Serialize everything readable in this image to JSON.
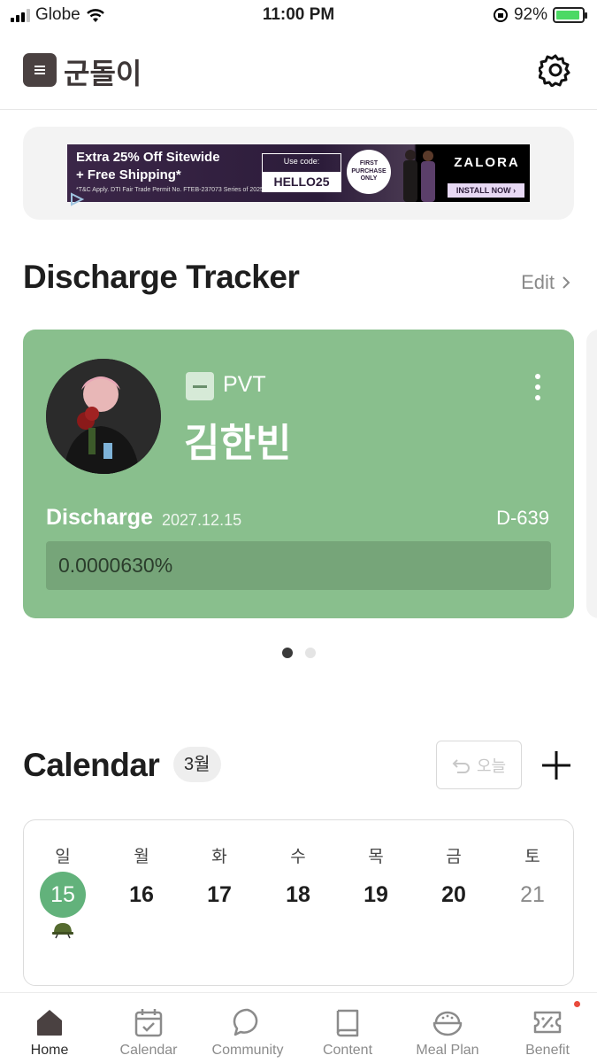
{
  "status_bar": {
    "carrier": "Globe",
    "time": "11:00 PM",
    "battery": "92%",
    "battery_level": 0.92
  },
  "header": {
    "title": "군돌이",
    "menu_icon": "menu-icon",
    "settings_icon": "gear-icon"
  },
  "ad": {
    "line1": "Extra 25% Off Sitewide",
    "line2": "+ Free Shipping*",
    "fine_print": "*T&C Apply. DTI Fair Trade Permit No. FTEB-237073 Series of 2025",
    "code_label": "Use code:",
    "code": "HELLO25",
    "badge": "FIRST PURCHASE ONLY",
    "brand": "ZALORA",
    "cta": "INSTALL NOW ›"
  },
  "discharge": {
    "title": "Discharge Tracker",
    "edit_label": "Edit",
    "card": {
      "rank": "PVT",
      "name": "김한빈",
      "discharge_label": "Discharge",
      "discharge_date": "2027.12.15",
      "dday": "D-639",
      "progress_text": "0.0000630%",
      "progress_fraction": 6.3e-07,
      "accent_color": "#89bf8d"
    },
    "pager": {
      "pages": 2,
      "active": 0
    }
  },
  "calendar": {
    "title": "Calendar",
    "month": "3월",
    "today_label": "오늘",
    "days": [
      {
        "dow": "일",
        "num": "15",
        "selected": true,
        "has_event": true
      },
      {
        "dow": "월",
        "num": "16"
      },
      {
        "dow": "화",
        "num": "17"
      },
      {
        "dow": "수",
        "num": "18"
      },
      {
        "dow": "목",
        "num": "19"
      },
      {
        "dow": "금",
        "num": "20"
      },
      {
        "dow": "토",
        "num": "21",
        "saturday": true
      }
    ]
  },
  "tabs": [
    {
      "label": "Home",
      "icon": "home-icon",
      "active": true
    },
    {
      "label": "Calendar",
      "icon": "calendar-icon"
    },
    {
      "label": "Community",
      "icon": "chat-bubble-icon"
    },
    {
      "label": "Content",
      "icon": "book-icon"
    },
    {
      "label": "Meal Plan",
      "icon": "rice-bowl-icon"
    },
    {
      "label": "Benefit",
      "icon": "coupon-icon",
      "badge": true
    }
  ]
}
